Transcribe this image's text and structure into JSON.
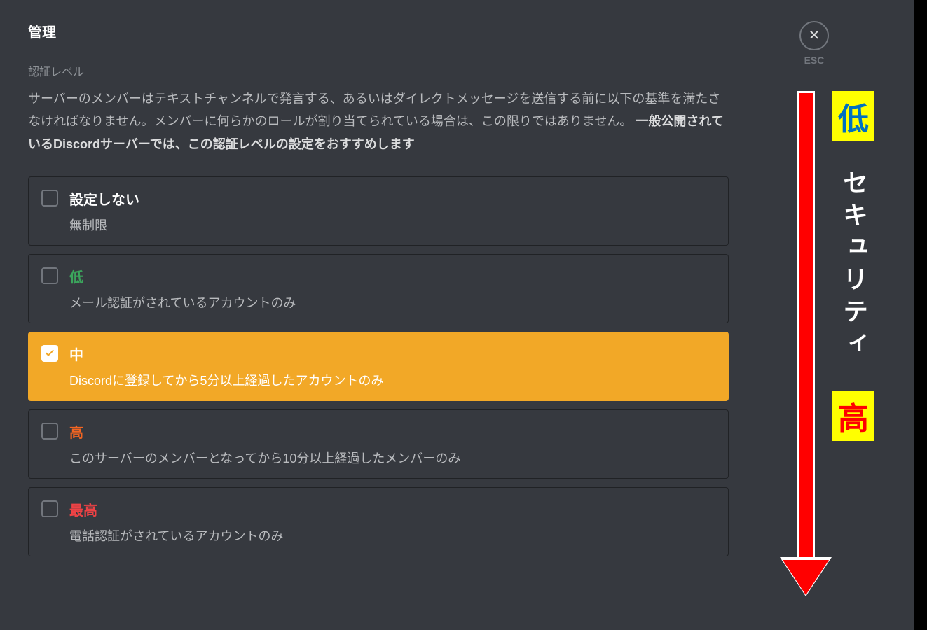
{
  "page": {
    "title": "管理",
    "section_label": "認証レベル",
    "description_part1": "サーバーのメンバーはテキストチャンネルで発言する、あるいはダイレクトメッセージを送信する前に以下の基準を満たさなければなりません。メンバーに何らかのロールが割り当てられている場合は、この限りではありません。 ",
    "description_bold": "一般公開されているDiscordサーバーでは、この認証レベルの設定をおすすめします"
  },
  "close": {
    "esc_label": "ESC"
  },
  "options": [
    {
      "title": "設定しない",
      "description": "無制限",
      "color_class": "white",
      "selected": false
    },
    {
      "title": "低",
      "description": "メール認証がされているアカウントのみ",
      "color_class": "green",
      "selected": false
    },
    {
      "title": "中",
      "description": "Discordに登録してから5分以上経過したアカウントのみ",
      "color_class": "selected-title",
      "selected": true
    },
    {
      "title": "高",
      "description": "このサーバーのメンバーとなってから10分以上経過したメンバーのみ",
      "color_class": "orange",
      "selected": false
    },
    {
      "title": "最高",
      "description": "電話認証がされているアカウントのみ",
      "color_class": "red",
      "selected": false
    }
  ],
  "annotation": {
    "top_badge": "低",
    "vertical_label": "セキュリティ",
    "bottom_badge": "高"
  }
}
